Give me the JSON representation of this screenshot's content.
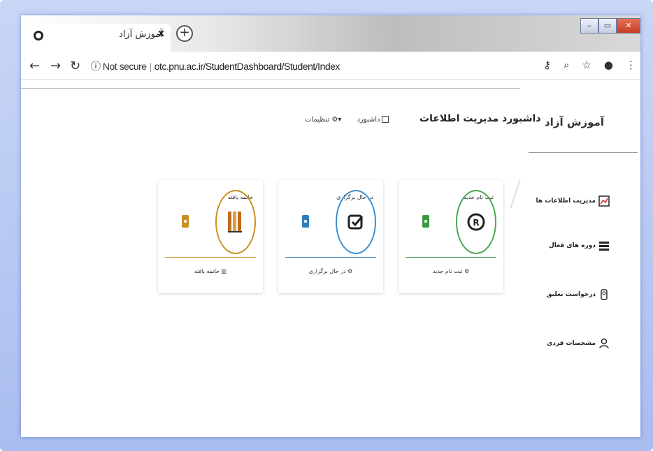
{
  "browser": {
    "tab_title": "آموزش آزاد",
    "tab_close": "x",
    "new_tab": "+",
    "not_secure": "Not secure",
    "url": "otc.pnu.ac.ir/StudentDashboard/Student/Index"
  },
  "header": {
    "brand": "آموزش آزاد",
    "dashboard_title": "داشبورد مدیریت اطلاعات",
    "nav_dashboard": "داشبورد",
    "nav_settings": "تنظیمات"
  },
  "sidebar": {
    "items": [
      {
        "label": "مدیریت اطلاعات ها"
      },
      {
        "label": "دوره های فعال"
      },
      {
        "label": "درخواست تعلیق"
      },
      {
        "label": "مشخصات فردی"
      }
    ]
  },
  "cards": [
    {
      "top_label": "ثبت نام جدید",
      "bottom_label": "ثبت نام جدید",
      "color": "#3a9a3f"
    },
    {
      "top_label": "در حال برگزاری",
      "bottom_label": "در حال برگزاری",
      "color": "#2b7fbf"
    },
    {
      "top_label": "خاتمه یافته",
      "bottom_label": "خاتمه یافته",
      "color": "#c9901f"
    }
  ]
}
